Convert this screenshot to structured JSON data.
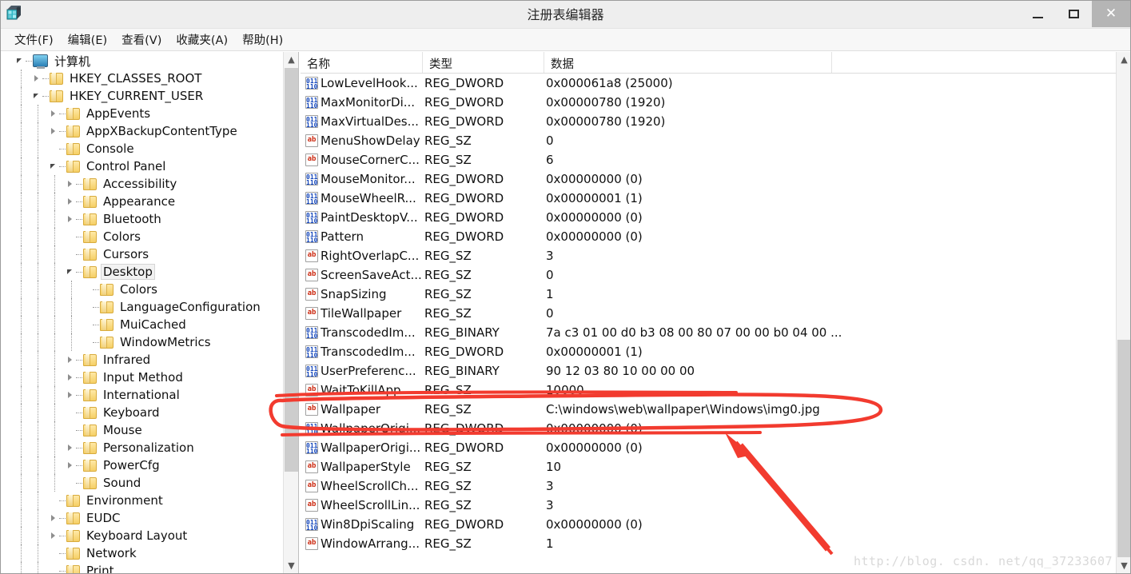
{
  "window": {
    "title": "注册表编辑器",
    "app_icon": "registry-editor-icon",
    "minimize_label": "—",
    "maximize_label": "□",
    "close_label": "✕"
  },
  "menu": {
    "items": [
      {
        "label": "文件(F)",
        "name": "menu-file"
      },
      {
        "label": "编辑(E)",
        "name": "menu-edit"
      },
      {
        "label": "查看(V)",
        "name": "menu-view"
      },
      {
        "label": "收藏夹(A)",
        "name": "menu-favorites"
      },
      {
        "label": "帮助(H)",
        "name": "menu-help"
      }
    ]
  },
  "tree": {
    "items": [
      {
        "label": "计算机",
        "depth": 0,
        "expander": "expanded",
        "icon": "computer-icon",
        "selected": false
      },
      {
        "label": "HKEY_CLASSES_ROOT",
        "depth": 1,
        "expander": "collapsed",
        "icon": "folder-icon",
        "selected": false
      },
      {
        "label": "HKEY_CURRENT_USER",
        "depth": 1,
        "expander": "expanded",
        "icon": "folder-icon",
        "selected": false
      },
      {
        "label": "AppEvents",
        "depth": 2,
        "expander": "collapsed",
        "icon": "folder-icon",
        "selected": false
      },
      {
        "label": "AppXBackupContentType",
        "depth": 2,
        "expander": "collapsed",
        "icon": "folder-icon",
        "selected": false
      },
      {
        "label": "Console",
        "depth": 2,
        "expander": "none",
        "icon": "folder-icon",
        "selected": false
      },
      {
        "label": "Control Panel",
        "depth": 2,
        "expander": "expanded",
        "icon": "folder-icon",
        "selected": false
      },
      {
        "label": "Accessibility",
        "depth": 3,
        "expander": "collapsed",
        "icon": "folder-icon",
        "selected": false
      },
      {
        "label": "Appearance",
        "depth": 3,
        "expander": "collapsed",
        "icon": "folder-icon",
        "selected": false
      },
      {
        "label": "Bluetooth",
        "depth": 3,
        "expander": "collapsed",
        "icon": "folder-icon",
        "selected": false
      },
      {
        "label": "Colors",
        "depth": 3,
        "expander": "none",
        "icon": "folder-icon",
        "selected": false
      },
      {
        "label": "Cursors",
        "depth": 3,
        "expander": "none",
        "icon": "folder-icon",
        "selected": false
      },
      {
        "label": "Desktop",
        "depth": 3,
        "expander": "expanded",
        "icon": "folder-icon",
        "selected": true
      },
      {
        "label": "Colors",
        "depth": 4,
        "expander": "none",
        "icon": "folder-icon",
        "selected": false
      },
      {
        "label": "LanguageConfiguration",
        "depth": 4,
        "expander": "none",
        "icon": "folder-icon",
        "selected": false
      },
      {
        "label": "MuiCached",
        "depth": 4,
        "expander": "none",
        "icon": "folder-icon",
        "selected": false
      },
      {
        "label": "WindowMetrics",
        "depth": 4,
        "expander": "none",
        "icon": "folder-icon",
        "selected": false
      },
      {
        "label": "Infrared",
        "depth": 3,
        "expander": "collapsed",
        "icon": "folder-icon",
        "selected": false
      },
      {
        "label": "Input Method",
        "depth": 3,
        "expander": "collapsed",
        "icon": "folder-icon",
        "selected": false
      },
      {
        "label": "International",
        "depth": 3,
        "expander": "collapsed",
        "icon": "folder-icon",
        "selected": false
      },
      {
        "label": "Keyboard",
        "depth": 3,
        "expander": "none",
        "icon": "folder-icon",
        "selected": false
      },
      {
        "label": "Mouse",
        "depth": 3,
        "expander": "none",
        "icon": "folder-icon",
        "selected": false
      },
      {
        "label": "Personalization",
        "depth": 3,
        "expander": "collapsed",
        "icon": "folder-icon",
        "selected": false
      },
      {
        "label": "PowerCfg",
        "depth": 3,
        "expander": "collapsed",
        "icon": "folder-icon",
        "selected": false
      },
      {
        "label": "Sound",
        "depth": 3,
        "expander": "none",
        "icon": "folder-icon",
        "selected": false
      },
      {
        "label": "Environment",
        "depth": 2,
        "expander": "none",
        "icon": "folder-icon",
        "selected": false
      },
      {
        "label": "EUDC",
        "depth": 2,
        "expander": "collapsed",
        "icon": "folder-icon",
        "selected": false
      },
      {
        "label": "Keyboard Layout",
        "depth": 2,
        "expander": "collapsed",
        "icon": "folder-icon",
        "selected": false
      },
      {
        "label": "Network",
        "depth": 2,
        "expander": "none",
        "icon": "folder-icon",
        "selected": false
      },
      {
        "label": "Print",
        "depth": 2,
        "expander": "none",
        "icon": "folder-icon",
        "selected": false
      }
    ]
  },
  "list": {
    "columns": [
      {
        "label": "名称",
        "name": "column-name"
      },
      {
        "label": "类型",
        "name": "column-type"
      },
      {
        "label": "数据",
        "name": "column-data"
      },
      {
        "label": "",
        "name": "column-filler"
      }
    ],
    "rows": [
      {
        "name": "LowLevelHook...",
        "type": "REG_DWORD",
        "data": "0x000061a8 (25000)",
        "icon": "binary-value-icon"
      },
      {
        "name": "MaxMonitorDi...",
        "type": "REG_DWORD",
        "data": "0x00000780 (1920)",
        "icon": "binary-value-icon"
      },
      {
        "name": "MaxVirtualDes...",
        "type": "REG_DWORD",
        "data": "0x00000780 (1920)",
        "icon": "binary-value-icon"
      },
      {
        "name": "MenuShowDelay",
        "type": "REG_SZ",
        "data": "0",
        "icon": "string-value-icon"
      },
      {
        "name": "MouseCornerC...",
        "type": "REG_SZ",
        "data": "6",
        "icon": "string-value-icon"
      },
      {
        "name": "MouseMonitor...",
        "type": "REG_DWORD",
        "data": "0x00000000 (0)",
        "icon": "binary-value-icon"
      },
      {
        "name": "MouseWheelR...",
        "type": "REG_DWORD",
        "data": "0x00000001 (1)",
        "icon": "binary-value-icon"
      },
      {
        "name": "PaintDesktopV...",
        "type": "REG_DWORD",
        "data": "0x00000000 (0)",
        "icon": "binary-value-icon"
      },
      {
        "name": "Pattern",
        "type": "REG_DWORD",
        "data": "0x00000000 (0)",
        "icon": "binary-value-icon"
      },
      {
        "name": "RightOverlapC...",
        "type": "REG_SZ",
        "data": "3",
        "icon": "string-value-icon"
      },
      {
        "name": "ScreenSaveAct...",
        "type": "REG_SZ",
        "data": "0",
        "icon": "string-value-icon"
      },
      {
        "name": "SnapSizing",
        "type": "REG_SZ",
        "data": "1",
        "icon": "string-value-icon"
      },
      {
        "name": "TileWallpaper",
        "type": "REG_SZ",
        "data": "0",
        "icon": "string-value-icon"
      },
      {
        "name": "TranscodedIm...",
        "type": "REG_BINARY",
        "data": "7a c3 01 00 d0 b3 08 00 80 07 00 00 b0 04 00 ...",
        "icon": "binary-value-icon"
      },
      {
        "name": "TranscodedIm...",
        "type": "REG_DWORD",
        "data": "0x00000001 (1)",
        "icon": "binary-value-icon"
      },
      {
        "name": "UserPreferenc...",
        "type": "REG_BINARY",
        "data": "90 12 03 80 10 00 00 00",
        "icon": "binary-value-icon"
      },
      {
        "name": "WaitToKillApp...",
        "type": "REG_SZ",
        "data": "10000",
        "icon": "string-value-icon"
      },
      {
        "name": "Wallpaper",
        "type": "REG_SZ",
        "data": "C:\\windows\\web\\wallpaper\\Windows\\img0.jpg",
        "icon": "string-value-icon"
      },
      {
        "name": "WallpaperOrigi...",
        "type": "REG_DWORD",
        "data": "0x00000000 (0)",
        "icon": "binary-value-icon"
      },
      {
        "name": "WallpaperOrigi...",
        "type": "REG_DWORD",
        "data": "0x00000000 (0)",
        "icon": "binary-value-icon"
      },
      {
        "name": "WallpaperStyle",
        "type": "REG_SZ",
        "data": "10",
        "icon": "string-value-icon"
      },
      {
        "name": "WheelScrollCh...",
        "type": "REG_SZ",
        "data": "3",
        "icon": "string-value-icon"
      },
      {
        "name": "WheelScrollLin...",
        "type": "REG_SZ",
        "data": "3",
        "icon": "string-value-icon"
      },
      {
        "name": "Win8DpiScaling",
        "type": "REG_DWORD",
        "data": "0x00000000 (0)",
        "icon": "binary-value-icon"
      },
      {
        "name": "WindowArrang...",
        "type": "REG_SZ",
        "data": "1",
        "icon": "string-value-icon"
      }
    ]
  },
  "annotations": {
    "color": "#f23b2f",
    "ellipse_target": "Wallpaper",
    "arrow_target": "Wallpaper"
  },
  "watermark": {
    "text": "http://blog. csdn. net/qq_37233607"
  }
}
